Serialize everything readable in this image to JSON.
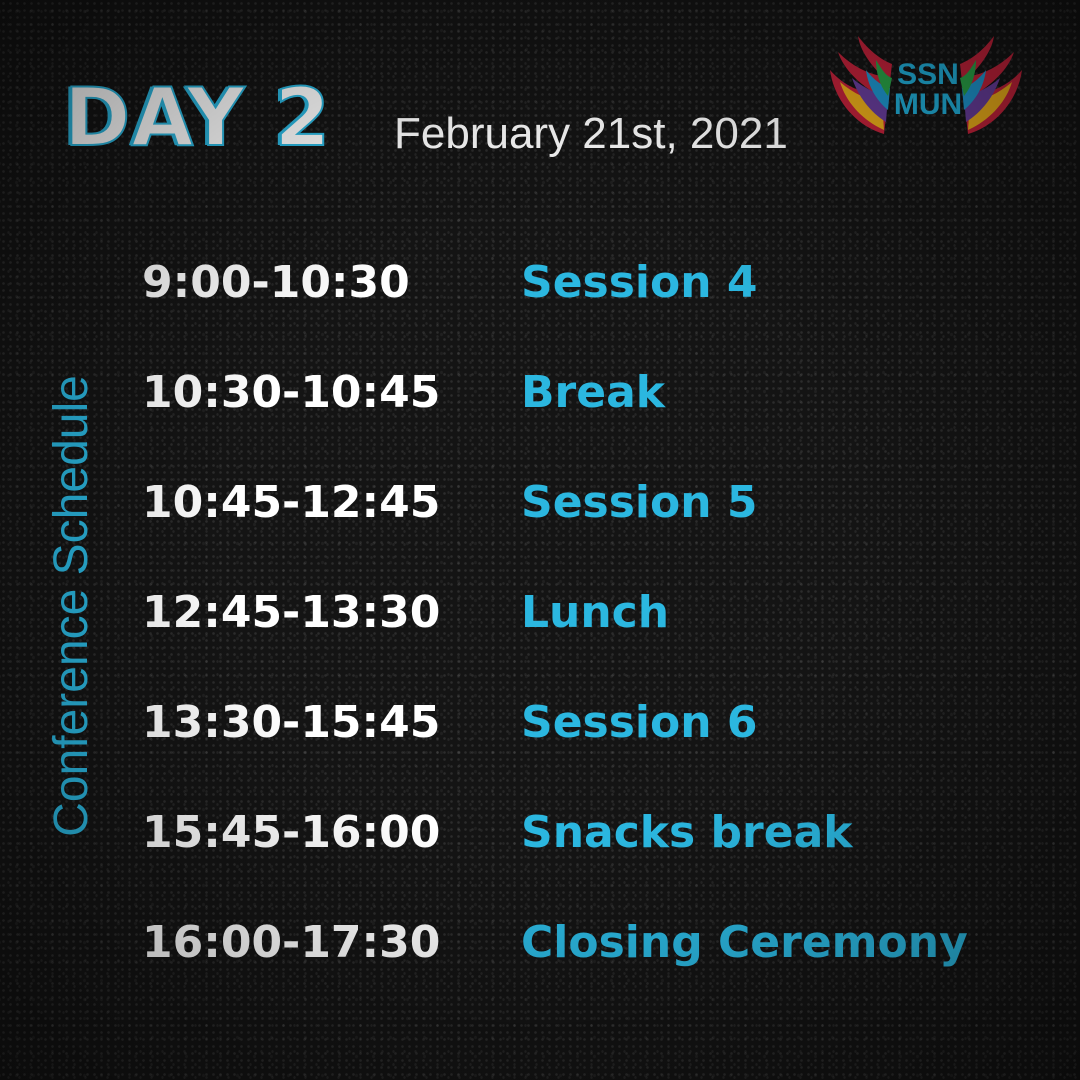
{
  "header": {
    "title": "DAY 2",
    "date": "February 21st, 2021"
  },
  "logo": {
    "line1": "SSN",
    "line2": "MUN",
    "icon": "wings-icon"
  },
  "side_title": "Conference Schedule",
  "schedule": [
    {
      "time": "9:00-10:30",
      "event": "Session 4"
    },
    {
      "time": "10:30-10:45",
      "event": "Break"
    },
    {
      "time": "10:45-12:45",
      "event": "Session 5"
    },
    {
      "time": "12:45-13:30",
      "event": "Lunch"
    },
    {
      "time": "13:30-15:45",
      "event": "Session 6"
    },
    {
      "time": "15:45-16:00",
      "event": "Snacks break"
    },
    {
      "time": "16:00-17:30",
      "event": "Closing Ceremony"
    }
  ],
  "colors": {
    "background": "#141414",
    "accent": "#2bb7e0",
    "text": "#ffffff"
  }
}
